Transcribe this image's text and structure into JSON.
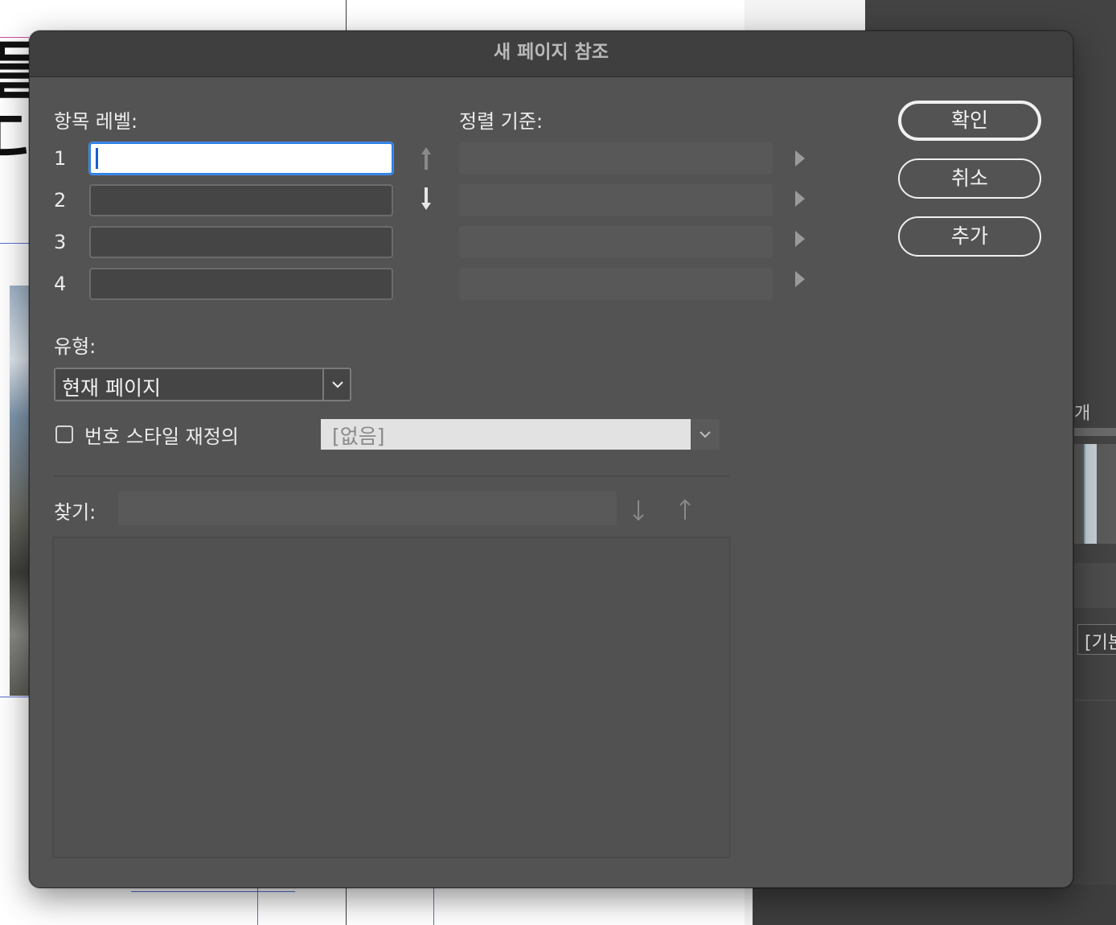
{
  "dialog": {
    "title": "새 페이지 참조",
    "entry_levels": {
      "label": "항목 레벨:",
      "rows": [
        {
          "number": "1",
          "value": ""
        },
        {
          "number": "2",
          "value": ""
        },
        {
          "number": "3",
          "value": ""
        },
        {
          "number": "4",
          "value": ""
        }
      ]
    },
    "sort_by": {
      "label": "정렬 기준:"
    },
    "buttons": {
      "ok": "확인",
      "cancel": "취소",
      "add": "추가"
    },
    "type": {
      "label": "유형:",
      "selected": "현재 페이지"
    },
    "number_style_override": {
      "label": "번호 스타일 재정의",
      "checked": false,
      "selected": "[없음]"
    },
    "find": {
      "label": "찾기:",
      "value": ""
    }
  },
  "background": {
    "doc_text_1": "들",
    "doc_text_2": "다",
    "panel_text_1": "개",
    "panel_box_text": "[기본"
  },
  "colors": {
    "dialog_bg": "#535353",
    "titlebar_bg": "#3f3f3f",
    "focus_blue": "#2d7fe6"
  },
  "icons": {
    "move_up": "arrow-up-icon",
    "move_down": "arrow-down-icon",
    "expand": "triangle-right-icon",
    "dropdown": "chevron-down-icon",
    "find_next": "arrow-down-icon",
    "find_prev": "arrow-up-icon"
  }
}
